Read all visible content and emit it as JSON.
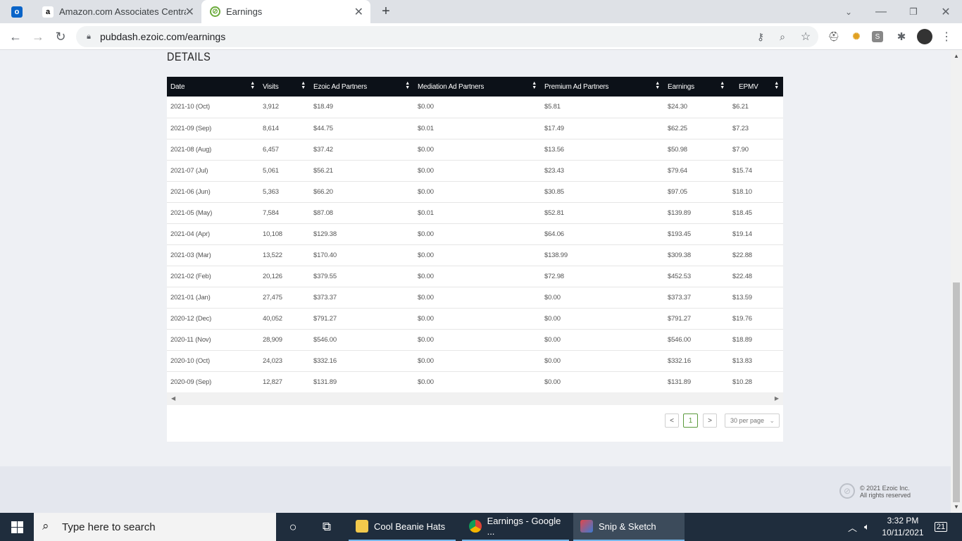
{
  "browser": {
    "tabs": [
      {
        "label": "Amazon.com Associates Central",
        "favicon": "amazon-favicon"
      },
      {
        "label": "Earnings",
        "favicon": "ezoic-favicon",
        "active": true
      }
    ],
    "url": "pubdash.ezoic.com/earnings"
  },
  "page": {
    "section_title": "DETAILS",
    "table": {
      "columns": [
        "Date",
        "Visits",
        "Ezoic Ad Partners",
        "Mediation Ad Partners",
        "Premium Ad Partners",
        "Earnings",
        "EPMV"
      ],
      "rows": [
        [
          "2021-10 (Oct)",
          "3,912",
          "$18.49",
          "$0.00",
          "$5.81",
          "$24.30",
          "$6.21"
        ],
        [
          "2021-09 (Sep)",
          "8,614",
          "$44.75",
          "$0.01",
          "$17.49",
          "$62.25",
          "$7.23"
        ],
        [
          "2021-08 (Aug)",
          "6,457",
          "$37.42",
          "$0.00",
          "$13.56",
          "$50.98",
          "$7.90"
        ],
        [
          "2021-07 (Jul)",
          "5,061",
          "$56.21",
          "$0.00",
          "$23.43",
          "$79.64",
          "$15.74"
        ],
        [
          "2021-06 (Jun)",
          "5,363",
          "$66.20",
          "$0.00",
          "$30.85",
          "$97.05",
          "$18.10"
        ],
        [
          "2021-05 (May)",
          "7,584",
          "$87.08",
          "$0.01",
          "$52.81",
          "$139.89",
          "$18.45"
        ],
        [
          "2021-04 (Apr)",
          "10,108",
          "$129.38",
          "$0.00",
          "$64.06",
          "$193.45",
          "$19.14"
        ],
        [
          "2021-03 (Mar)",
          "13,522",
          "$170.40",
          "$0.00",
          "$138.99",
          "$309.38",
          "$22.88"
        ],
        [
          "2021-02 (Feb)",
          "20,126",
          "$379.55",
          "$0.00",
          "$72.98",
          "$452.53",
          "$22.48"
        ],
        [
          "2021-01 (Jan)",
          "27,475",
          "$373.37",
          "$0.00",
          "$0.00",
          "$373.37",
          "$13.59"
        ],
        [
          "2020-12 (Dec)",
          "40,052",
          "$791.27",
          "$0.00",
          "$0.00",
          "$791.27",
          "$19.76"
        ],
        [
          "2020-11 (Nov)",
          "28,909",
          "$546.00",
          "$0.00",
          "$0.00",
          "$546.00",
          "$18.89"
        ],
        [
          "2020-10 (Oct)",
          "24,023",
          "$332.16",
          "$0.00",
          "$0.00",
          "$332.16",
          "$13.83"
        ],
        [
          "2020-09 (Sep)",
          "12,827",
          "$131.89",
          "$0.00",
          "$0.00",
          "$131.89",
          "$10.28"
        ]
      ]
    },
    "pagination": {
      "prev": "<",
      "current_page": "1",
      "next": ">",
      "per_page": "30 per page"
    },
    "footer": {
      "copyright": "© 2021 Ezoic Inc.",
      "rights": "All rights reserved"
    }
  },
  "taskbar": {
    "search_placeholder": "Type here to search",
    "apps": [
      {
        "label": "Cool Beanie Hats",
        "icon": "folder-icon"
      },
      {
        "label": "Earnings - Google ...",
        "icon": "chrome-icon"
      },
      {
        "label": "Snip & Sketch",
        "icon": "snip-sketch-icon"
      }
    ],
    "time": "3:32 PM",
    "date": "10/11/2021",
    "notification_count": "21"
  },
  "colors": {
    "table_header_bg": "#0c1118",
    "accent_green": "#5a9a3c",
    "page_bg": "#eef0f4",
    "taskbar_bg": "#1f2d3d"
  }
}
